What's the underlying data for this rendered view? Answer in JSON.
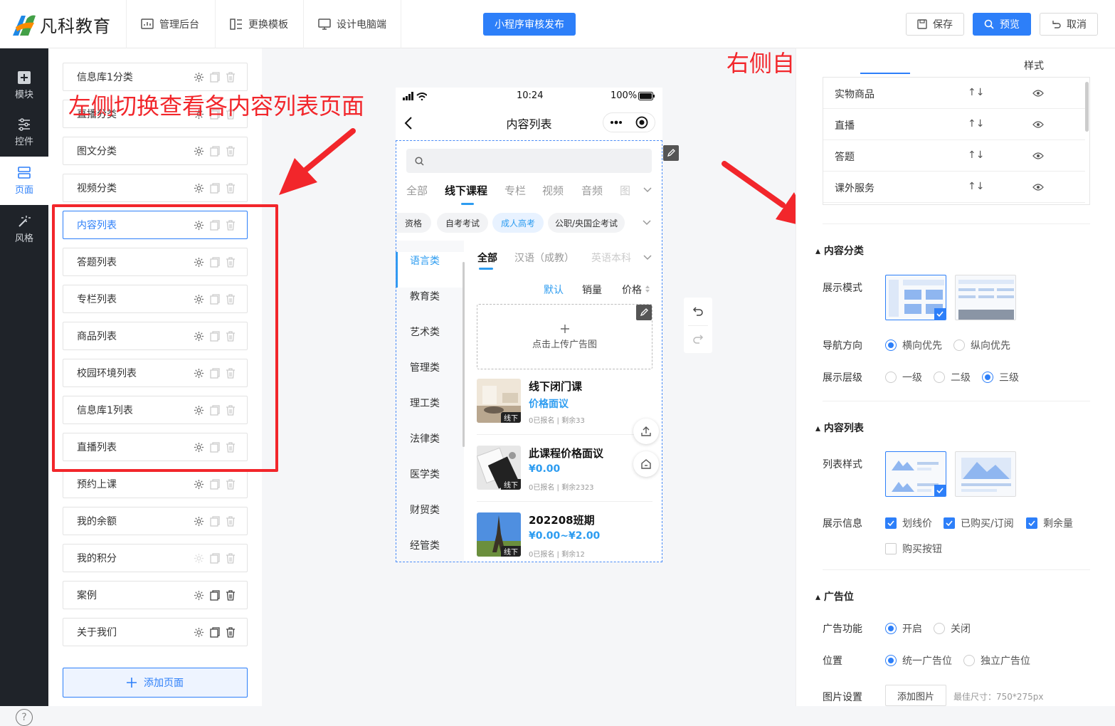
{
  "logo": {
    "text": "凡科教育"
  },
  "topbar": {
    "admin_label": "管理后台",
    "template_label": "更换模板",
    "desktop_label": "设计电脑端",
    "publish_label": "小程序审核发布",
    "save_label": "保存",
    "preview_label": "预览",
    "cancel_label": "取消"
  },
  "leftnav": {
    "items": [
      {
        "label": "模块"
      },
      {
        "label": "控件"
      },
      {
        "label": "页面"
      },
      {
        "label": "风格"
      }
    ],
    "help": "?"
  },
  "pages": {
    "items": [
      {
        "label": "信息库1分类"
      },
      {
        "label": "直播分类"
      },
      {
        "label": "图文分类"
      },
      {
        "label": "视频分类"
      },
      {
        "label": "内容列表"
      },
      {
        "label": "答题列表"
      },
      {
        "label": "专栏列表"
      },
      {
        "label": "商品列表"
      },
      {
        "label": "校园环境列表"
      },
      {
        "label": "信息库1列表"
      },
      {
        "label": "直播列表"
      },
      {
        "label": "预约上课"
      },
      {
        "label": "我的余额"
      },
      {
        "label": "我的积分"
      },
      {
        "label": "案例"
      },
      {
        "label": "关于我们"
      }
    ],
    "add_label": "添加页面"
  },
  "annotations": {
    "left": "左侧切换查看各内容列表页面",
    "right": "右侧自定义设置页面内容及样式"
  },
  "phone": {
    "time": "10:24",
    "battery": "100%",
    "title": "内容列表",
    "tabs": [
      "全部",
      "线下课程",
      "专栏",
      "视频",
      "音频",
      "图"
    ],
    "chips": [
      "资格",
      "自考考试",
      "成人高考",
      "公职/央国企考试"
    ],
    "categories": [
      "语言类",
      "教育类",
      "艺术类",
      "管理类",
      "理工类",
      "法律类",
      "医学类",
      "财贸类",
      "经管类"
    ],
    "subtabs": [
      "全部",
      "汉语（成教）",
      "英语本科"
    ],
    "sorts": [
      "默认",
      "销量",
      "价格"
    ],
    "ad_text": "点击上传广告图",
    "courses": [
      {
        "title": "线下闭门课",
        "price": "价格面议",
        "meta": "0已报名 | 剩余33",
        "tag": "线下"
      },
      {
        "title": "此课程价格面议",
        "price": "¥0.00",
        "meta": "0已报名 | 剩余2323",
        "tag": "线下"
      },
      {
        "title": "202208班期",
        "price": "¥0.00~¥2.00",
        "meta": "0已报名 | 剩余12",
        "tag": "线下"
      }
    ]
  },
  "rpanel": {
    "tab_style": "样式",
    "table_rows": [
      "实物商品",
      "直播",
      "答题",
      "课外服务"
    ],
    "sort_glyph": "↑↓",
    "sec_category": "内容分类",
    "display_mode_label": "展示模式",
    "nav_dir_label": "导航方向",
    "nav_dir_options": [
      "横向优先",
      "纵向优先"
    ],
    "level_label": "展示层级",
    "level_options": [
      "一级",
      "二级",
      "三级"
    ],
    "sec_list": "内容列表",
    "list_style_label": "列表样式",
    "info_label": "展示信息",
    "info_options": [
      "划线价",
      "已购买/订阅",
      "剩余量",
      "购买按钮"
    ],
    "sec_ad": "广告位",
    "ad_func_label": "广告功能",
    "ad_func_options": [
      "开启",
      "关闭"
    ],
    "position_label": "位置",
    "position_options": [
      "统一广告位",
      "独立广告位"
    ],
    "img_label": "图片设置",
    "add_img_label": "添加图片",
    "img_hint": "最佳尺寸：750*275px"
  },
  "colors": {
    "accent": "#2d7ff9",
    "annotation": "#f2262b",
    "phone_accent": "#2d9cf0"
  }
}
